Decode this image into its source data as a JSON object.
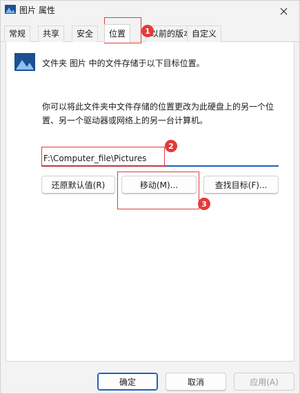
{
  "window": {
    "title": "图片 属性"
  },
  "tabs": [
    {
      "label": "常规"
    },
    {
      "label": "共享"
    },
    {
      "label": "安全"
    },
    {
      "label": "位置"
    },
    {
      "label": "以前的版本"
    },
    {
      "label": "自定义"
    }
  ],
  "location": {
    "description": "文件夹 图片 中的文件存储于以下目标位置。",
    "long_description": "你可以将此文件夹中文件存储的位置更改为此硬盘上的另一个位置、另一个驱动器或网络上的另一台计算机。",
    "path_value": "F:\\Computer_file\\Pictures",
    "restore_default_label": "还原默认值(R)",
    "move_label": "移动(M)...",
    "find_target_label": "查找目标(F)..."
  },
  "footer": {
    "ok_label": "确定",
    "cancel_label": "取消",
    "apply_label": "应用(A)"
  },
  "annotations": [
    "1",
    "2",
    "3"
  ],
  "colors": {
    "accent": "#1f5fbf",
    "annotation": "#e23b3b"
  }
}
